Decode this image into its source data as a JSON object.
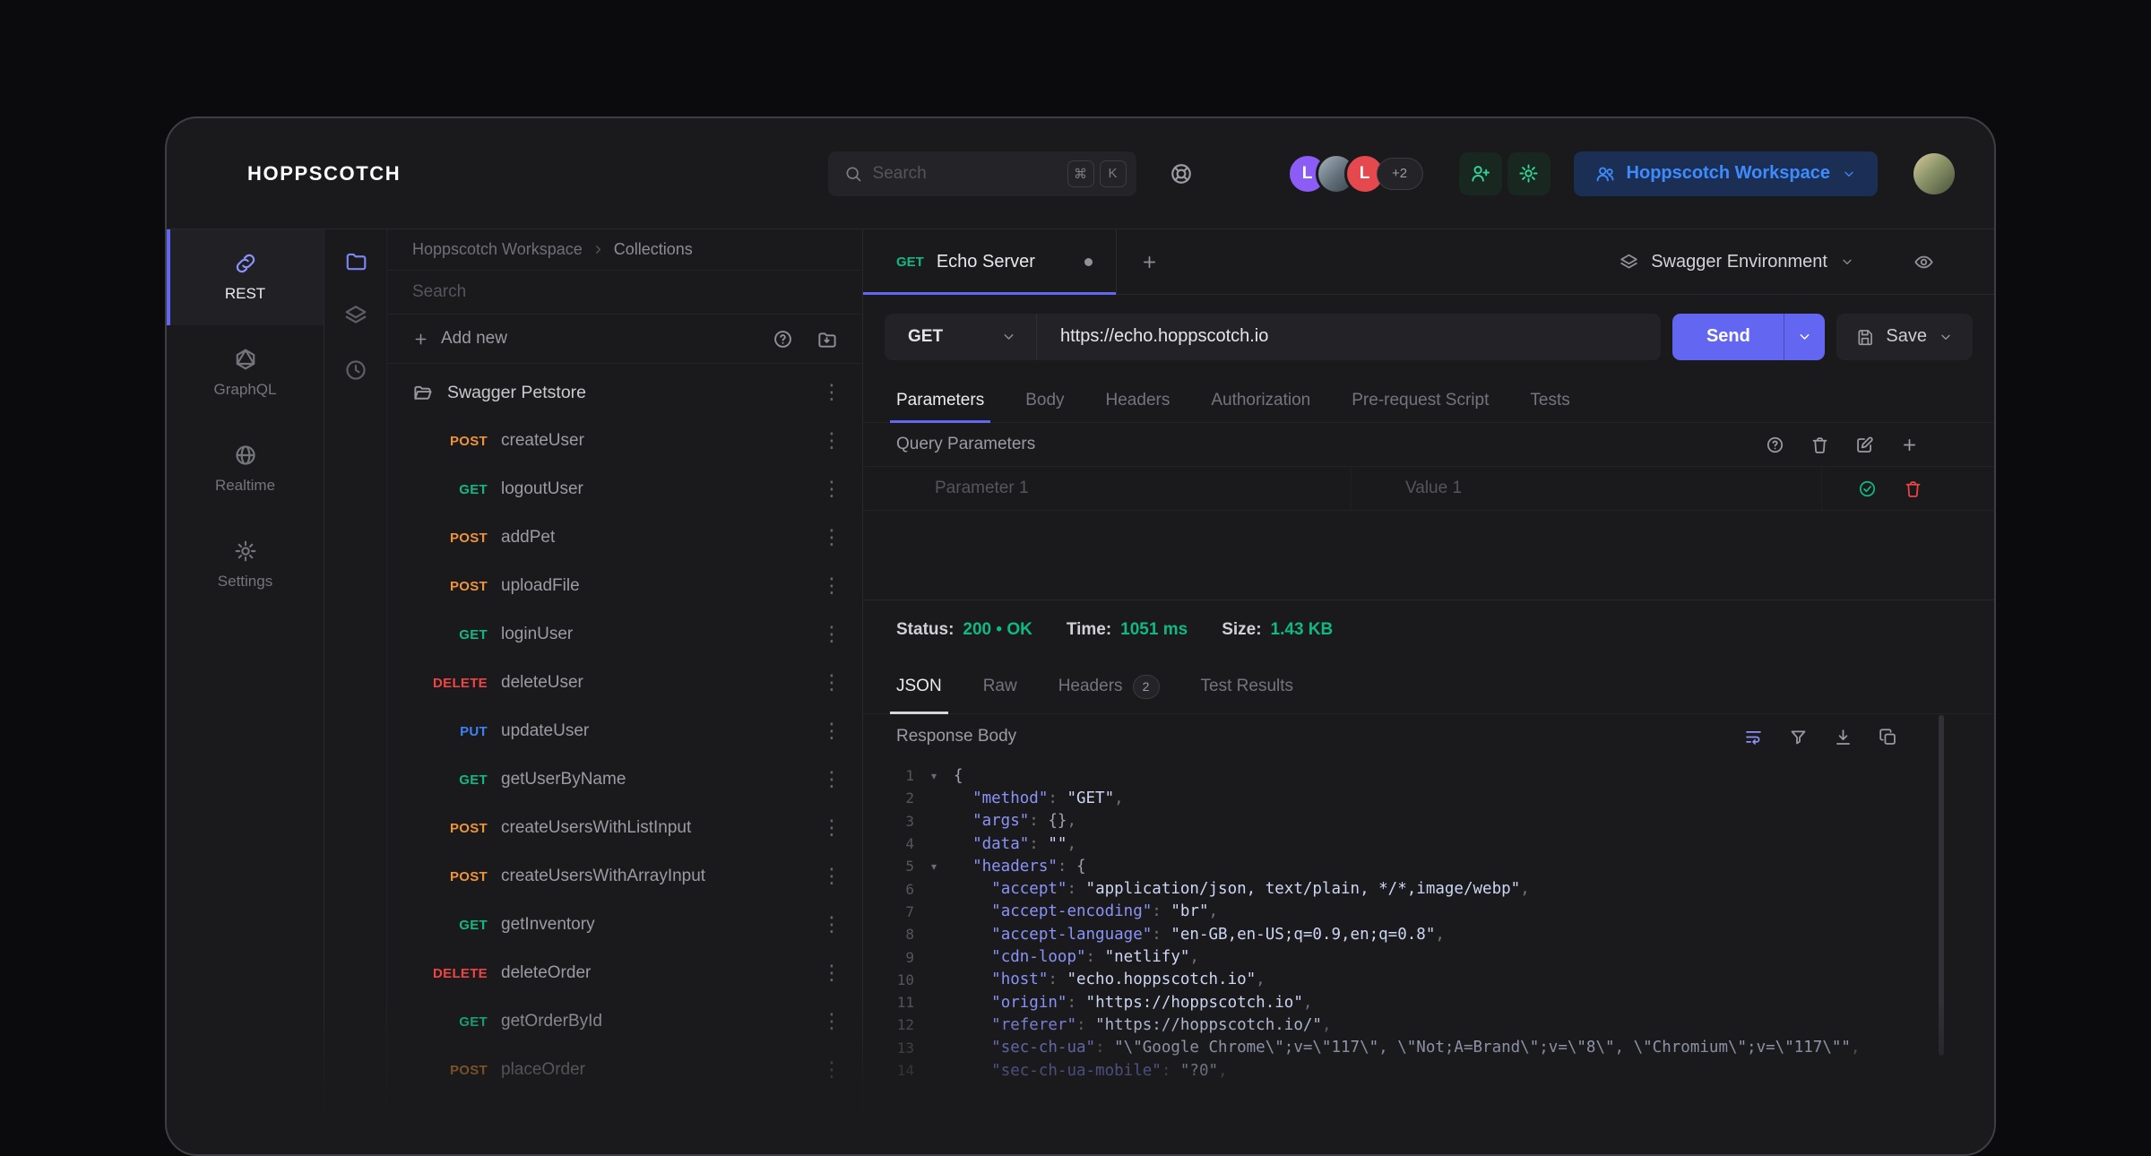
{
  "colors": {
    "accent": "#6366f1",
    "method_get": "#10b981",
    "method_post": "#ef9436",
    "method_put": "#3b82f6",
    "method_delete": "#ef4444",
    "success_green": "#10b981",
    "danger_red": "#ef4444"
  },
  "header": {
    "logo": "HOPPSCOTCH",
    "search": {
      "placeholder": "Search",
      "shortcut_keys": [
        "⌘",
        "K"
      ]
    },
    "avatars": {
      "initials": [
        "L",
        "",
        "L"
      ],
      "overflow": "+2"
    },
    "workspace_button": "Hoppscotch Workspace"
  },
  "nav": {
    "items": [
      {
        "label": "REST"
      },
      {
        "label": "GraphQL"
      },
      {
        "label": "Realtime"
      },
      {
        "label": "Settings"
      }
    ]
  },
  "collections": {
    "breadcrumb": {
      "workspace": "Hoppscotch Workspace",
      "section": "Collections"
    },
    "search_placeholder": "Search",
    "add_new_label": "Add new",
    "folder_name": "Swagger Petstore",
    "requests": [
      {
        "method": "POST",
        "name": "createUser"
      },
      {
        "method": "GET",
        "name": "logoutUser"
      },
      {
        "method": "POST",
        "name": "addPet"
      },
      {
        "method": "POST",
        "name": "uploadFile"
      },
      {
        "method": "GET",
        "name": "loginUser"
      },
      {
        "method": "DELETE",
        "name": "deleteUser"
      },
      {
        "method": "PUT",
        "name": "updateUser"
      },
      {
        "method": "GET",
        "name": "getUserByName"
      },
      {
        "method": "POST",
        "name": "createUsersWithListInput"
      },
      {
        "method": "POST",
        "name": "createUsersWithArrayInput"
      },
      {
        "method": "GET",
        "name": "getInventory"
      },
      {
        "method": "DELETE",
        "name": "deleteOrder"
      },
      {
        "method": "GET",
        "name": "getOrderById"
      },
      {
        "method": "POST",
        "name": "placeOrder"
      }
    ]
  },
  "request": {
    "tab": {
      "method": "GET",
      "title": "Echo Server"
    },
    "environment": "Swagger Environment",
    "method": "GET",
    "url": "https://echo.hoppscotch.io",
    "send_label": "Send",
    "save_label": "Save",
    "tabs": [
      "Parameters",
      "Body",
      "Headers",
      "Authorization",
      "Pre-request Script",
      "Tests"
    ],
    "active_tab": "Parameters",
    "query_parameters": {
      "title": "Query Parameters",
      "param_placeholder": "Parameter 1",
      "value_placeholder": "Value 1"
    }
  },
  "response": {
    "meta": {
      "status_label": "Status:",
      "status_value": "200 • OK",
      "time_label": "Time:",
      "time_value": "1051 ms",
      "size_label": "Size:",
      "size_value": "1.43 KB"
    },
    "tabs": [
      {
        "label": "JSON"
      },
      {
        "label": "Raw"
      },
      {
        "label": "Headers",
        "badge": "2"
      },
      {
        "label": "Test Results"
      }
    ],
    "active_tab": "JSON",
    "body_label": "Response Body",
    "code": [
      {
        "n": 1,
        "fold": true,
        "tokens": [
          [
            "b",
            "{"
          ]
        ]
      },
      {
        "n": 2,
        "tokens": [
          [
            "b",
            "  "
          ],
          [
            "k",
            "\"method\""
          ],
          [
            "p",
            ": "
          ],
          [
            "s",
            "\"GET\""
          ],
          [
            "p",
            ","
          ]
        ]
      },
      {
        "n": 3,
        "tokens": [
          [
            "b",
            "  "
          ],
          [
            "k",
            "\"args\""
          ],
          [
            "p",
            ": "
          ],
          [
            "b",
            "{}"
          ],
          [
            "p",
            ","
          ]
        ]
      },
      {
        "n": 4,
        "tokens": [
          [
            "b",
            "  "
          ],
          [
            "k",
            "\"data\""
          ],
          [
            "p",
            ": "
          ],
          [
            "s",
            "\"\""
          ],
          [
            "p",
            ","
          ]
        ]
      },
      {
        "n": 5,
        "fold": true,
        "tokens": [
          [
            "b",
            "  "
          ],
          [
            "k",
            "\"headers\""
          ],
          [
            "p",
            ": "
          ],
          [
            "b",
            "{"
          ]
        ]
      },
      {
        "n": 6,
        "tokens": [
          [
            "b",
            "    "
          ],
          [
            "k",
            "\"accept\""
          ],
          [
            "p",
            ": "
          ],
          [
            "s",
            "\"application/json, text/plain, */*,image/webp\""
          ],
          [
            "p",
            ","
          ]
        ]
      },
      {
        "n": 7,
        "tokens": [
          [
            "b",
            "    "
          ],
          [
            "k",
            "\"accept-encoding\""
          ],
          [
            "p",
            ": "
          ],
          [
            "s",
            "\"br\""
          ],
          [
            "p",
            ","
          ]
        ]
      },
      {
        "n": 8,
        "tokens": [
          [
            "b",
            "    "
          ],
          [
            "k",
            "\"accept-language\""
          ],
          [
            "p",
            ": "
          ],
          [
            "s",
            "\"en-GB,en-US;q=0.9,en;q=0.8\""
          ],
          [
            "p",
            ","
          ]
        ]
      },
      {
        "n": 9,
        "tokens": [
          [
            "b",
            "    "
          ],
          [
            "k",
            "\"cdn-loop\""
          ],
          [
            "p",
            ": "
          ],
          [
            "s",
            "\"netlify\""
          ],
          [
            "p",
            ","
          ]
        ]
      },
      {
        "n": 10,
        "tokens": [
          [
            "b",
            "    "
          ],
          [
            "k",
            "\"host\""
          ],
          [
            "p",
            ": "
          ],
          [
            "s",
            "\"echo.hoppscotch.io\""
          ],
          [
            "p",
            ","
          ]
        ]
      },
      {
        "n": 11,
        "tokens": [
          [
            "b",
            "    "
          ],
          [
            "k",
            "\"origin\""
          ],
          [
            "p",
            ": "
          ],
          [
            "s",
            "\"https://hoppscotch.io\""
          ],
          [
            "p",
            ","
          ]
        ]
      },
      {
        "n": 12,
        "tokens": [
          [
            "b",
            "    "
          ],
          [
            "k",
            "\"referer\""
          ],
          [
            "p",
            ": "
          ],
          [
            "s",
            "\"https://hoppscotch.io/\""
          ],
          [
            "p",
            ","
          ]
        ]
      },
      {
        "n": 13,
        "tokens": [
          [
            "b",
            "    "
          ],
          [
            "k",
            "\"sec-ch-ua\""
          ],
          [
            "p",
            ": "
          ],
          [
            "s",
            "\"\\\"Google Chrome\\\";v=\\\"117\\\", \\\"Not;A=Brand\\\";v=\\\"8\\\", \\\"Chromium\\\";v=\\\"117\\\"\""
          ],
          [
            "p",
            ","
          ]
        ]
      },
      {
        "n": 14,
        "tokens": [
          [
            "b",
            "    "
          ],
          [
            "k",
            "\"sec-ch-ua-mobile\""
          ],
          [
            "p",
            ": "
          ],
          [
            "s",
            "\"?0\""
          ],
          [
            "p",
            ","
          ]
        ]
      }
    ]
  }
}
